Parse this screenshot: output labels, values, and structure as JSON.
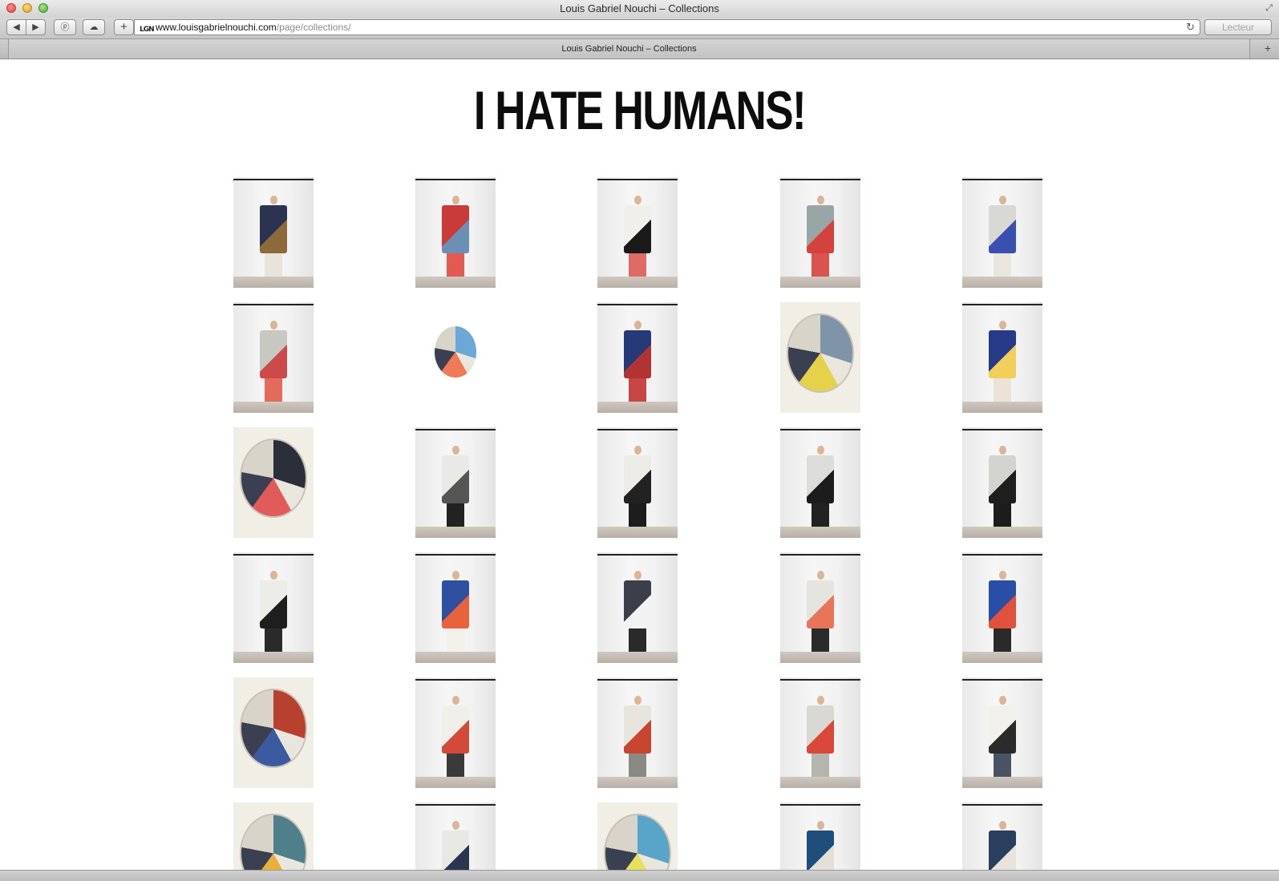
{
  "window": {
    "title": "Louis Gabriel Nouchi – Collections"
  },
  "toolbar": {
    "back_icon": "◀",
    "forward_icon": "▶",
    "pinterest_icon": "ⓟ",
    "cloud_icon": "☁",
    "add_icon": "+",
    "favicon_text": "LGN",
    "url_host": "www.louisgabrielnouchi.com",
    "url_path": "/page/collections/",
    "reload_icon": "↻",
    "reader_label": "Lecteur"
  },
  "tabbar": {
    "tab_title": "Louis Gabriel Nouchi – Collections",
    "new_tab_icon": "+"
  },
  "page": {
    "headline": "I HATE HUMANS!"
  },
  "gallery": [
    {
      "kind": "look",
      "garment": "#2b3350",
      "accent": "#8d6a3a",
      "legs": "#e8e4dc"
    },
    {
      "kind": "look",
      "garment": "#c93b3b",
      "accent": "#6b8fb5",
      "legs": "#e45a50"
    },
    {
      "kind": "look",
      "garment": "#f0efea",
      "accent": "#1a1a1a",
      "legs": "#e06a66"
    },
    {
      "kind": "look",
      "garment": "#9aa6a6",
      "accent": "#d4423d",
      "legs": "#d9534f"
    },
    {
      "kind": "look",
      "garment": "#d8d8d4",
      "accent": "#3a4fb0",
      "legs": "#e9e6de"
    },
    {
      "kind": "look",
      "garment": "#c8c8c2",
      "accent": "#cc4a4a",
      "legs": "#e36b5d"
    },
    {
      "kind": "small-art",
      "garment": "#6ba8d8",
      "accent": "#ef7a55",
      "legs": "#ffffff"
    },
    {
      "kind": "look",
      "garment": "#263a78",
      "accent": "#b23333",
      "legs": "#c84646"
    },
    {
      "kind": "circle-art",
      "garment": "#7f94a8",
      "accent": "#e6d24a",
      "legs": "#ffffff"
    },
    {
      "kind": "look",
      "garment": "#273a8a",
      "accent": "#f2cf5a",
      "legs": "#eae3d6"
    },
    {
      "kind": "circle-art",
      "garment": "#2a2f3a",
      "accent": "#e25b5b",
      "legs": "#ffffff"
    },
    {
      "kind": "look",
      "garment": "#e9e9e6",
      "accent": "#555555",
      "legs": "#222222"
    },
    {
      "kind": "look",
      "garment": "#ecebe6",
      "accent": "#222222",
      "legs": "#1d1d1d"
    },
    {
      "kind": "look",
      "garment": "#dcdcd8",
      "accent": "#1c1c1c",
      "legs": "#222222"
    },
    {
      "kind": "look",
      "garment": "#d3d3d0",
      "accent": "#1e1e1e",
      "legs": "#1c1c1c"
    },
    {
      "kind": "look",
      "garment": "#ecece8",
      "accent": "#1e1e1e",
      "legs": "#2a2a2a"
    },
    {
      "kind": "look",
      "garment": "#2f4fa0",
      "accent": "#e8623c",
      "legs": "#f3f1ea"
    },
    {
      "kind": "look",
      "garment": "#3a3f4a",
      "accent": "#f2f2f2",
      "legs": "#2a2a2a"
    },
    {
      "kind": "look",
      "garment": "#e6e4de",
      "accent": "#e8745a",
      "legs": "#2b2b2b"
    },
    {
      "kind": "look",
      "garment": "#2a4ea6",
      "accent": "#e0523c",
      "legs": "#2a2a2a"
    },
    {
      "kind": "circle-art",
      "garment": "#b8402f",
      "accent": "#3b5aa0",
      "legs": "#ffffff"
    },
    {
      "kind": "look",
      "garment": "#f1efe9",
      "accent": "#d24a3a",
      "legs": "#3a3a3a"
    },
    {
      "kind": "look",
      "garment": "#e8e5de",
      "accent": "#c8452f",
      "legs": "#8a8a84"
    },
    {
      "kind": "look",
      "garment": "#d9d8d2",
      "accent": "#d8493a",
      "legs": "#b5b5ad"
    },
    {
      "kind": "look",
      "garment": "#f2f0ea",
      "accent": "#2b2b2b",
      "legs": "#4a5363"
    },
    {
      "kind": "circle-art",
      "garment": "#4f7f8a",
      "accent": "#e6b03a",
      "legs": "#ffffff"
    },
    {
      "kind": "look",
      "garment": "#e8e8e4",
      "accent": "#2a3550",
      "legs": "#2a2a2a"
    },
    {
      "kind": "circle-art",
      "garment": "#58a5c9",
      "accent": "#e8e05a",
      "legs": "#ffffff"
    },
    {
      "kind": "look",
      "garment": "#1f4e7a",
      "accent": "#e4e0d8",
      "legs": "#2a2a2a"
    },
    {
      "kind": "look",
      "garment": "#2a3e5e",
      "accent": "#e8e4dc",
      "legs": "#2a2a2a"
    }
  ]
}
